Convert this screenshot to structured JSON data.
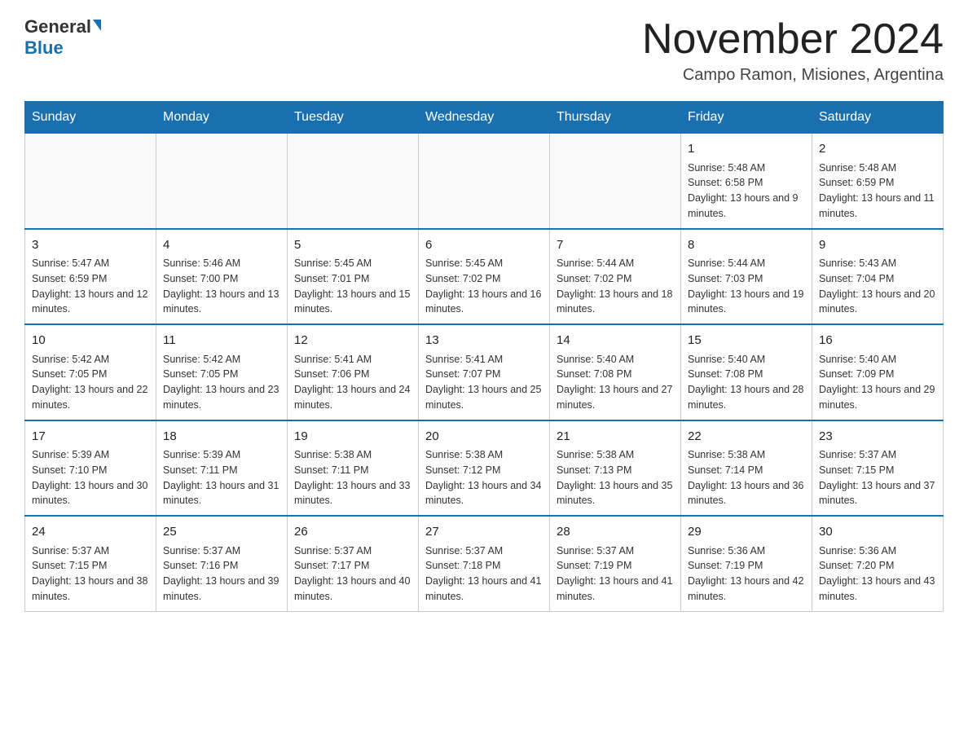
{
  "header": {
    "logo_text_general": "General",
    "logo_text_blue": "Blue",
    "month_title": "November 2024",
    "location": "Campo Ramon, Misiones, Argentina"
  },
  "calendar": {
    "days_of_week": [
      "Sunday",
      "Monday",
      "Tuesday",
      "Wednesday",
      "Thursday",
      "Friday",
      "Saturday"
    ],
    "weeks": [
      [
        {
          "day": "",
          "info": ""
        },
        {
          "day": "",
          "info": ""
        },
        {
          "day": "",
          "info": ""
        },
        {
          "day": "",
          "info": ""
        },
        {
          "day": "",
          "info": ""
        },
        {
          "day": "1",
          "info": "Sunrise: 5:48 AM\nSunset: 6:58 PM\nDaylight: 13 hours and 9 minutes."
        },
        {
          "day": "2",
          "info": "Sunrise: 5:48 AM\nSunset: 6:59 PM\nDaylight: 13 hours and 11 minutes."
        }
      ],
      [
        {
          "day": "3",
          "info": "Sunrise: 5:47 AM\nSunset: 6:59 PM\nDaylight: 13 hours and 12 minutes."
        },
        {
          "day": "4",
          "info": "Sunrise: 5:46 AM\nSunset: 7:00 PM\nDaylight: 13 hours and 13 minutes."
        },
        {
          "day": "5",
          "info": "Sunrise: 5:45 AM\nSunset: 7:01 PM\nDaylight: 13 hours and 15 minutes."
        },
        {
          "day": "6",
          "info": "Sunrise: 5:45 AM\nSunset: 7:02 PM\nDaylight: 13 hours and 16 minutes."
        },
        {
          "day": "7",
          "info": "Sunrise: 5:44 AM\nSunset: 7:02 PM\nDaylight: 13 hours and 18 minutes."
        },
        {
          "day": "8",
          "info": "Sunrise: 5:44 AM\nSunset: 7:03 PM\nDaylight: 13 hours and 19 minutes."
        },
        {
          "day": "9",
          "info": "Sunrise: 5:43 AM\nSunset: 7:04 PM\nDaylight: 13 hours and 20 minutes."
        }
      ],
      [
        {
          "day": "10",
          "info": "Sunrise: 5:42 AM\nSunset: 7:05 PM\nDaylight: 13 hours and 22 minutes."
        },
        {
          "day": "11",
          "info": "Sunrise: 5:42 AM\nSunset: 7:05 PM\nDaylight: 13 hours and 23 minutes."
        },
        {
          "day": "12",
          "info": "Sunrise: 5:41 AM\nSunset: 7:06 PM\nDaylight: 13 hours and 24 minutes."
        },
        {
          "day": "13",
          "info": "Sunrise: 5:41 AM\nSunset: 7:07 PM\nDaylight: 13 hours and 25 minutes."
        },
        {
          "day": "14",
          "info": "Sunrise: 5:40 AM\nSunset: 7:08 PM\nDaylight: 13 hours and 27 minutes."
        },
        {
          "day": "15",
          "info": "Sunrise: 5:40 AM\nSunset: 7:08 PM\nDaylight: 13 hours and 28 minutes."
        },
        {
          "day": "16",
          "info": "Sunrise: 5:40 AM\nSunset: 7:09 PM\nDaylight: 13 hours and 29 minutes."
        }
      ],
      [
        {
          "day": "17",
          "info": "Sunrise: 5:39 AM\nSunset: 7:10 PM\nDaylight: 13 hours and 30 minutes."
        },
        {
          "day": "18",
          "info": "Sunrise: 5:39 AM\nSunset: 7:11 PM\nDaylight: 13 hours and 31 minutes."
        },
        {
          "day": "19",
          "info": "Sunrise: 5:38 AM\nSunset: 7:11 PM\nDaylight: 13 hours and 33 minutes."
        },
        {
          "day": "20",
          "info": "Sunrise: 5:38 AM\nSunset: 7:12 PM\nDaylight: 13 hours and 34 minutes."
        },
        {
          "day": "21",
          "info": "Sunrise: 5:38 AM\nSunset: 7:13 PM\nDaylight: 13 hours and 35 minutes."
        },
        {
          "day": "22",
          "info": "Sunrise: 5:38 AM\nSunset: 7:14 PM\nDaylight: 13 hours and 36 minutes."
        },
        {
          "day": "23",
          "info": "Sunrise: 5:37 AM\nSunset: 7:15 PM\nDaylight: 13 hours and 37 minutes."
        }
      ],
      [
        {
          "day": "24",
          "info": "Sunrise: 5:37 AM\nSunset: 7:15 PM\nDaylight: 13 hours and 38 minutes."
        },
        {
          "day": "25",
          "info": "Sunrise: 5:37 AM\nSunset: 7:16 PM\nDaylight: 13 hours and 39 minutes."
        },
        {
          "day": "26",
          "info": "Sunrise: 5:37 AM\nSunset: 7:17 PM\nDaylight: 13 hours and 40 minutes."
        },
        {
          "day": "27",
          "info": "Sunrise: 5:37 AM\nSunset: 7:18 PM\nDaylight: 13 hours and 41 minutes."
        },
        {
          "day": "28",
          "info": "Sunrise: 5:37 AM\nSunset: 7:19 PM\nDaylight: 13 hours and 41 minutes."
        },
        {
          "day": "29",
          "info": "Sunrise: 5:36 AM\nSunset: 7:19 PM\nDaylight: 13 hours and 42 minutes."
        },
        {
          "day": "30",
          "info": "Sunrise: 5:36 AM\nSunset: 7:20 PM\nDaylight: 13 hours and 43 minutes."
        }
      ]
    ]
  }
}
